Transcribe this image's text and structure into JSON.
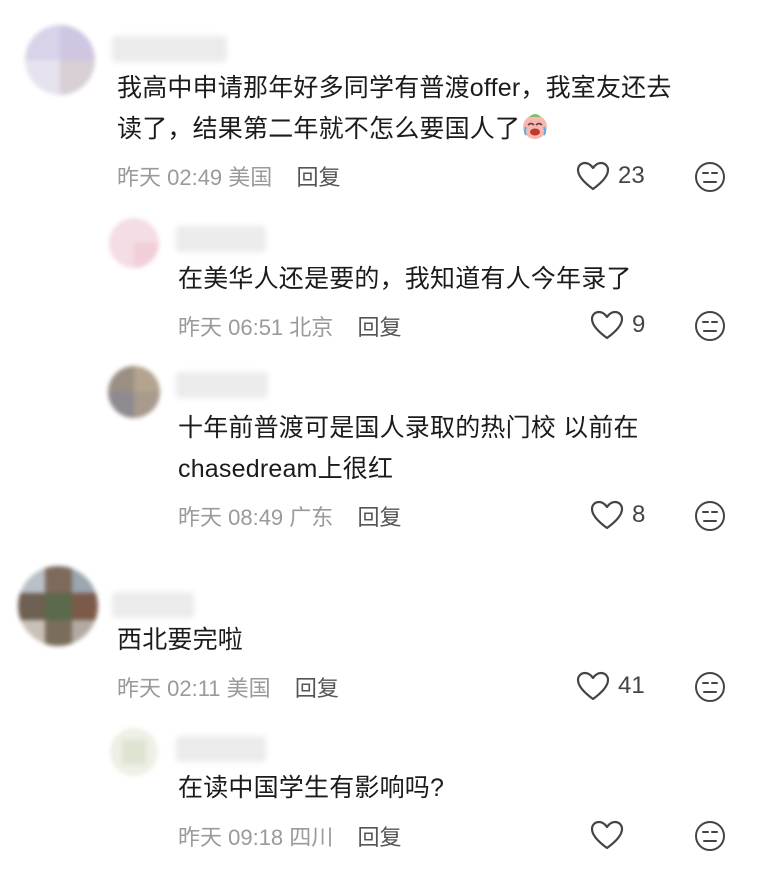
{
  "comments": [
    {
      "text_line1": "我高中申请那年好多同学有普渡offer，我室友还去",
      "text_line2": "读了，结果第二年就不怎么要国人了",
      "time": "昨天 02:49",
      "location": "美国",
      "reply_label": "回复",
      "likes": "23",
      "inline_emoji": "crying-laugh-emoji"
    },
    {
      "text_line1": "在美华人还是要的，我知道有人今年录了",
      "time": "昨天 06:51",
      "location": "北京",
      "reply_label": "回复",
      "likes": "9"
    },
    {
      "text_line1": "十年前普渡可是国人录取的热门校 以前在",
      "text_line2": "chasedream上很红",
      "time": "昨天 08:49",
      "location": "广东",
      "reply_label": "回复",
      "likes": "8"
    },
    {
      "text_line1": "西北要完啦",
      "time": "昨天 02:11",
      "location": "美国",
      "reply_label": "回复",
      "likes": "41"
    },
    {
      "text_line1": "在读中国学生有影响吗?",
      "time": "昨天 09:18",
      "location": "四川",
      "reply_label": "回复",
      "likes": ""
    }
  ],
  "icons": {
    "like": "heart-outline-icon",
    "reaction": "neutral-face-icon"
  }
}
